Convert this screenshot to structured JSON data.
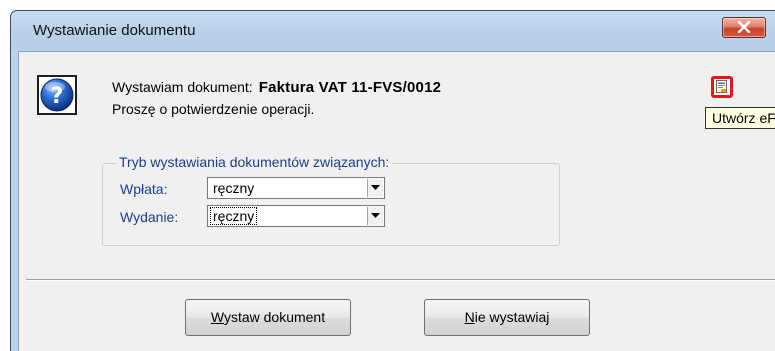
{
  "window": {
    "title": "Wystawianie dokumentu",
    "close_icon": "close-icon"
  },
  "message": {
    "icon": "help-question-icon",
    "line1_prefix": "Wystawiam dokument:",
    "document_name": "Faktura VAT 11-FVS/0012",
    "line2": "Proszę o potwierdzenie operacji."
  },
  "efaktura": {
    "icon": "efaktura-icon",
    "tooltip": "Utwórz eFakturę"
  },
  "related_docs": {
    "legend": "Tryb wystawiania dokumentów związanych:",
    "fields": [
      {
        "label": "Wpłata:",
        "value": "ręczny"
      },
      {
        "label": "Wydanie:",
        "value": "ręczny"
      }
    ]
  },
  "buttons": {
    "issue": {
      "accel": "W",
      "rest": "ystaw dokument"
    },
    "cancel": {
      "accel": "N",
      "rest": "ie wystawiaj"
    }
  },
  "colors": {
    "accent_label": "#1a3f8f",
    "close_button": "#c7432a",
    "tooltip_bg": "#ffffe1",
    "efaktura_highlight": "#e8131b"
  }
}
